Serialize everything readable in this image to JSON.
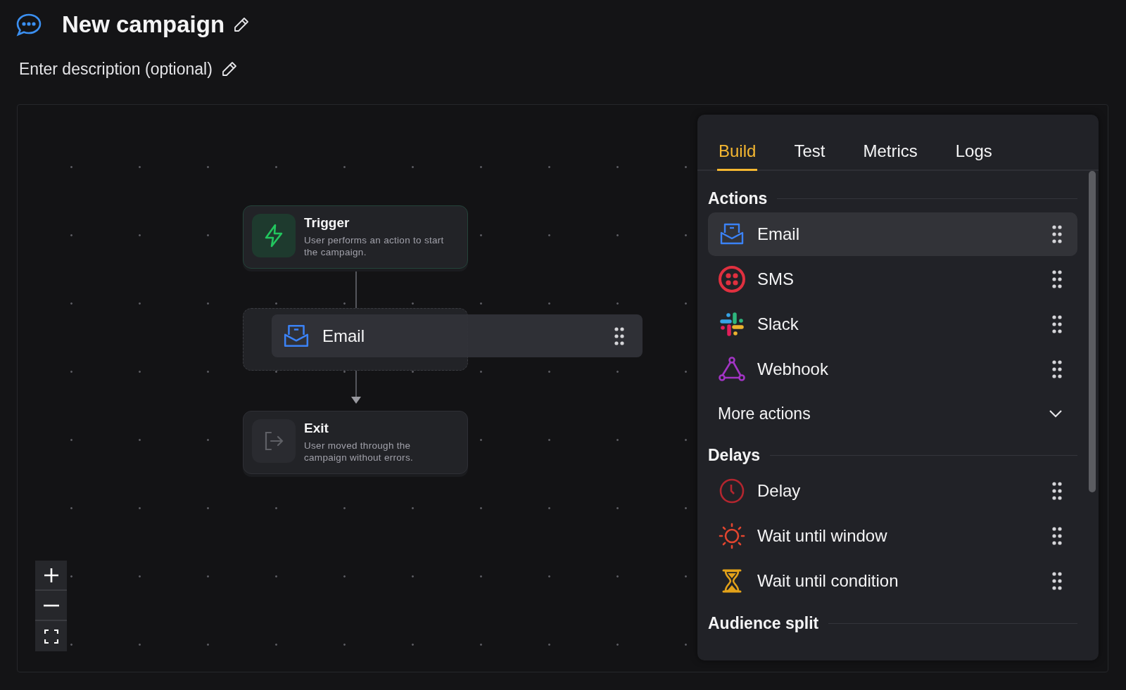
{
  "header": {
    "title": "New campaign",
    "description_hint": "Enter description (optional)"
  },
  "canvas": {
    "nodes": [
      {
        "kind": "trigger",
        "title": "Trigger",
        "description": "User performs an action to start the campaign."
      },
      {
        "kind": "placeholder",
        "title": "Email"
      },
      {
        "kind": "exit",
        "title": "Exit",
        "description": "User moved through the campaign without errors."
      }
    ]
  },
  "panel": {
    "tabs": [
      {
        "label": "Build",
        "selected": true
      },
      {
        "label": "Test",
        "selected": false
      },
      {
        "label": "Metrics",
        "selected": false
      },
      {
        "label": "Logs",
        "selected": false
      }
    ],
    "sections": [
      {
        "heading": "Actions",
        "items": [
          {
            "label": "Email",
            "selected": true
          },
          {
            "label": "SMS",
            "selected": false
          },
          {
            "label": "Slack",
            "selected": false
          },
          {
            "label": "Webhook",
            "selected": false
          }
        ],
        "more": {
          "label": "More actions",
          "expanded": false
        }
      },
      {
        "heading": "Delays",
        "items": [
          {
            "label": "Delay",
            "selected": false
          },
          {
            "label": "Wait until window",
            "selected": false
          },
          {
            "label": "Wait until condition",
            "selected": false
          }
        ]
      },
      {
        "heading": "Audience split"
      }
    ]
  }
}
